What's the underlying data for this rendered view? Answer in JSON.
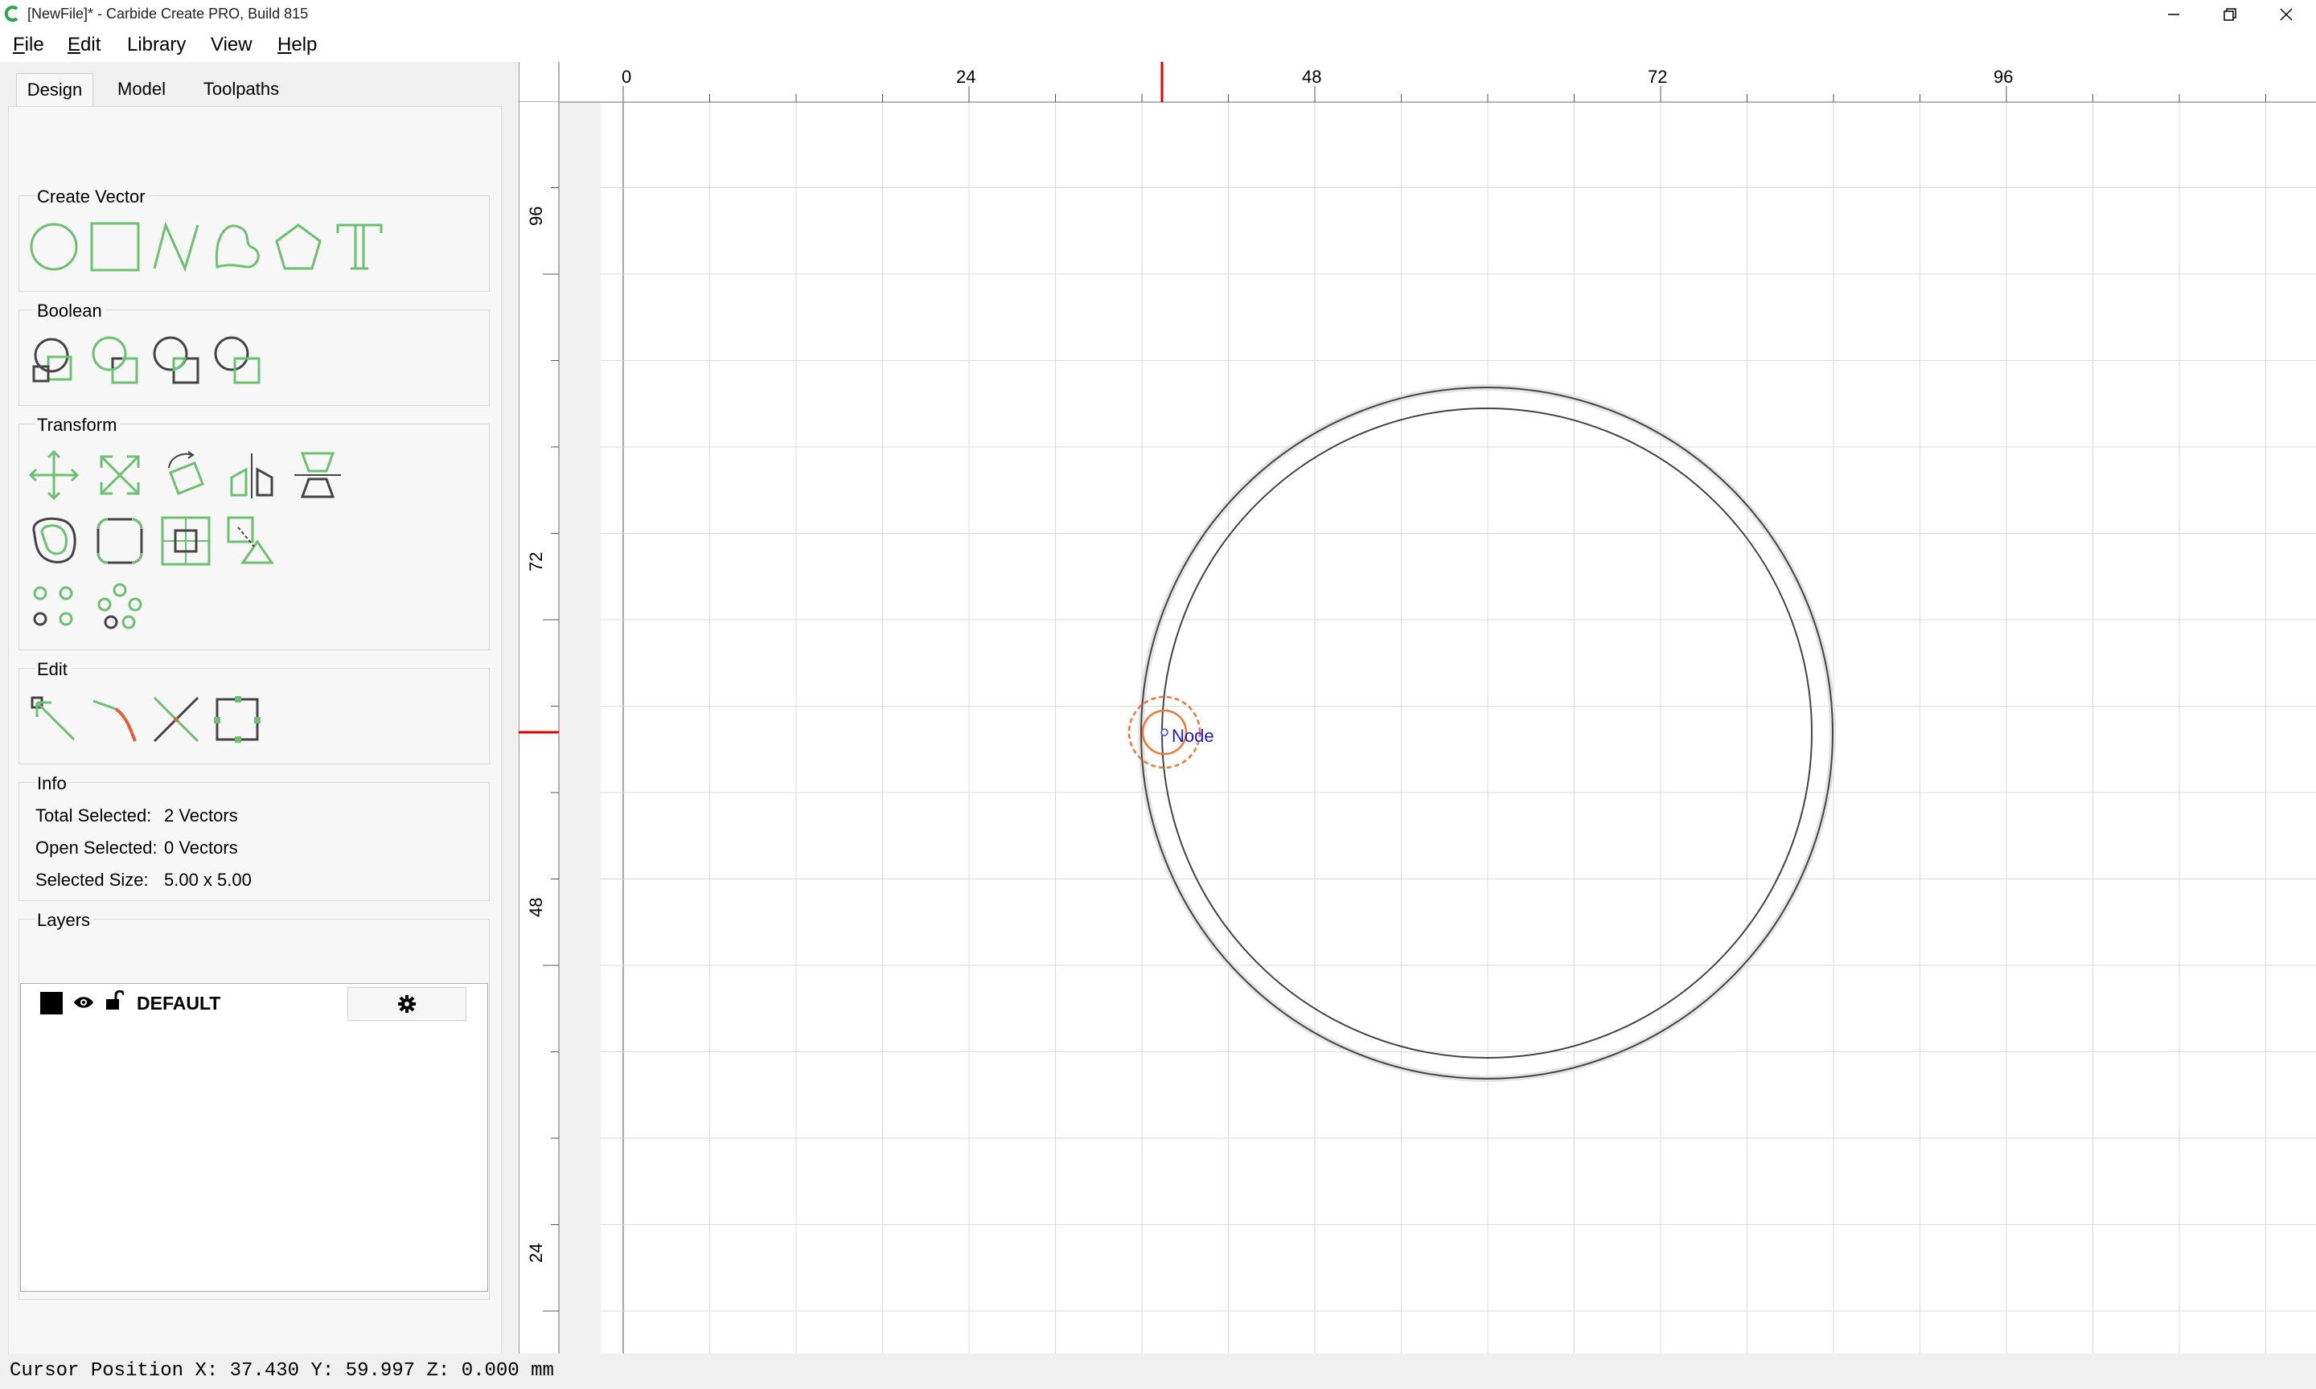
{
  "window": {
    "title": "[NewFile]* - Carbide Create PRO, Build 815",
    "app_icon": "carbide-c-icon",
    "controls": [
      "minimize-icon",
      "restore-icon",
      "close-icon"
    ]
  },
  "menu": {
    "items": [
      {
        "accel": "F",
        "rest": "ile"
      },
      {
        "accel": "E",
        "rest": "dit"
      },
      {
        "accel": "",
        "rest": "Library"
      },
      {
        "accel": "",
        "rest": "View"
      },
      {
        "accel": "H",
        "rest": "elp"
      }
    ]
  },
  "tabs": {
    "items": [
      "Design",
      "Model",
      "Toolpaths"
    ],
    "active": "Design"
  },
  "groups": {
    "create_vector": "Create Vector",
    "boolean": "Boolean",
    "transform": "Transform",
    "edit": "Edit",
    "info": "Info",
    "layers": "Layers"
  },
  "tools": {
    "create_vector": [
      "circle-tool-icon",
      "rectangle-tool-icon",
      "polyline-tool-icon",
      "curve-tool-icon",
      "polygon-tool-icon",
      "text-tool-icon"
    ],
    "boolean": [
      "union-icon",
      "subtract-icon",
      "intersect-icon",
      "weld-icon"
    ],
    "transform_row1": [
      "move-icon",
      "scale-icon",
      "rotate-icon",
      "mirror-icon",
      "flip-icon"
    ],
    "transform_row2": [
      "offset-icon",
      "fillet-icon",
      "align-icon",
      "distort-icon"
    ],
    "transform_row3": [
      "linear-array-icon",
      "circular-array-icon"
    ],
    "edit": [
      "node-edit-icon",
      "trim-icon",
      "cut-icon",
      "join-icon"
    ]
  },
  "info": {
    "total_selected_label": "Total Selected:",
    "total_selected_value": "2 Vectors",
    "open_selected_label": "Open Selected:",
    "open_selected_value": "0 Vectors",
    "selected_size_label": "Selected Size:",
    "selected_size_value": "5.00 x 5.00"
  },
  "layers": {
    "items": [
      {
        "name": "DEFAULT",
        "color": "#000000",
        "visible": true,
        "locked": false
      }
    ],
    "settings_icon": "gear-icon"
  },
  "canvas": {
    "ruler_top_labels": [
      "0",
      "24",
      "48",
      "72",
      "96"
    ],
    "ruler_left_labels": [
      "96",
      "72",
      "48",
      "24"
    ],
    "node_label": "Node",
    "grid_color": "#d8d8d8",
    "marker_color": "#e00000",
    "node_color": "#ee7733"
  },
  "status": {
    "cursor_position": "Cursor Position X: 37.430 Y: 59.997 Z: 0.000 mm"
  }
}
